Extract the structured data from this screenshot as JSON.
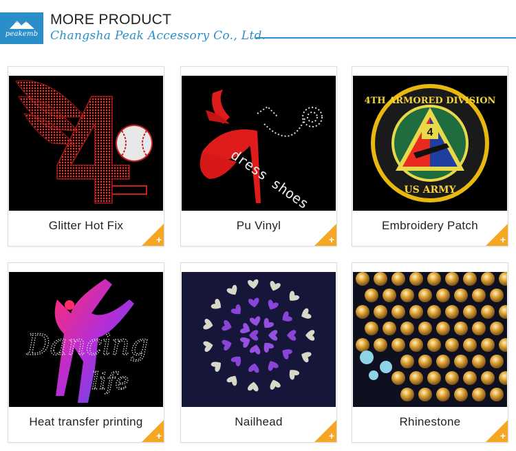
{
  "header": {
    "logo_text": "peakemb",
    "title": "MORE PRODUCT",
    "subtitle": "Changsha Peak Accessory Co., Ltd."
  },
  "products": [
    {
      "label": "Glitter Hot Fix",
      "corner_icon": "plus-icon"
    },
    {
      "label": "Pu Vinyl",
      "corner_icon": "plus-icon"
    },
    {
      "label": "Embroidery Patch",
      "corner_icon": "plus-icon"
    },
    {
      "label": "Heat transfer printing",
      "corner_icon": "plus-icon"
    },
    {
      "label": "Nailhead",
      "corner_icon": "plus-icon"
    },
    {
      "label": "Rhinestone",
      "corner_icon": "plus-icon"
    }
  ],
  "artwork_text": {
    "vinyl_words": "dress shoes",
    "patch_top": "4TH ARMORED DIVISION",
    "patch_bottom": "US ARMY",
    "patch_number": "4",
    "dancing_word": "Dancing",
    "life_word": "life"
  },
  "colors": {
    "brand_blue": "#2a8fc8",
    "corner_orange": "#f5a623",
    "glitter_red": "#c8201f"
  }
}
